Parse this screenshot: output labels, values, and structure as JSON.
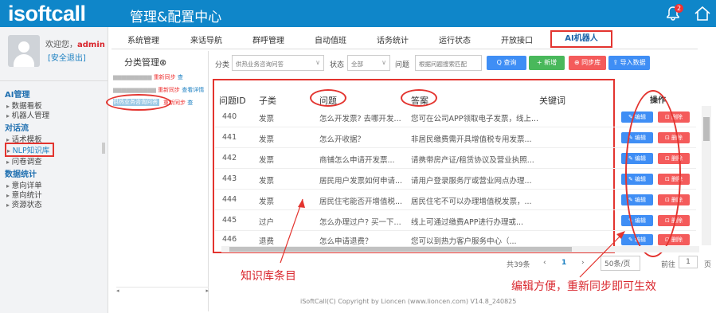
{
  "header": {
    "logo": "isoftcall",
    "title": "管理&配置中心",
    "notification_count": "2"
  },
  "sidebar": {
    "welcome_prefix": "欢迎您，",
    "username": "admin",
    "logout": "[安全退出]",
    "sections": [
      {
        "title": "AI管理",
        "items": [
          "数据看板",
          "机器人管理"
        ]
      },
      {
        "title": "对话流",
        "items": [
          "话术模板",
          "NLP知识库",
          "问卷调查"
        ]
      },
      {
        "title": "数据统计",
        "items": [
          "意向详单",
          "意向统计",
          "资源状态"
        ]
      }
    ]
  },
  "tabs": [
    "系统管理",
    "来话导航",
    "群呼管理",
    "自动值班",
    "话务统计",
    "运行状态",
    "开放接口",
    "AI机器人"
  ],
  "category_panel": {
    "title": "分类管理⊗",
    "rows": [
      {
        "label": "",
        "red": "重新同步",
        "blue": "查"
      },
      {
        "label": "",
        "red": "重新同步",
        "blue": "查看详情"
      },
      {
        "label": "",
        "red": "重新同步",
        "blue": "查"
      }
    ],
    "selected": "供热业务咨询问答"
  },
  "filters": {
    "category_label": "分类",
    "category_value": "供热业务咨询问答",
    "status_label": "状态",
    "status_value": "全部",
    "question_label": "问题",
    "question_placeholder": "根据问题搜索匹配"
  },
  "buttons": {
    "search": "Q 查询",
    "add": "+ 新增",
    "sync": "⊕ 同步库",
    "import": "⇪ 导入数据"
  },
  "table": {
    "headers": [
      "问题ID",
      "子类",
      "问题",
      "答案",
      "关键词"
    ],
    "op_header": "操作",
    "edit_label": "✎ 编辑",
    "delete_label": "⊡ 删除",
    "rows": [
      {
        "id": "440",
        "sub": "发票",
        "question": "怎么开发票? 去哪开发...",
        "answer": "您可在公司APP领取电子发票，线上..."
      },
      {
        "id": "441",
        "sub": "发票",
        "question": "怎么开收据？",
        "answer": "非居民缴费需开具增值税专用发票..."
      },
      {
        "id": "442",
        "sub": "发票",
        "question": "商铺怎么申请开发票...",
        "answer": "请携带房产证/租赁协议及营业执照..."
      },
      {
        "id": "443",
        "sub": "发票",
        "question": "居民用户发票如何申请...",
        "answer": "请用户登录服务厅或营业网点办理..."
      },
      {
        "id": "444",
        "sub": "发票",
        "question": "居民住宅能否开增值税...",
        "answer": "居民住宅不可以办理增值税发票，..."
      },
      {
        "id": "445",
        "sub": "过户",
        "question": "怎么办理过户? 买一下...",
        "answer": "线上可通过缴费APP进行办理或..."
      },
      {
        "id": "446",
        "sub": "退费",
        "question": "怎么申请退费？",
        "answer": "您可以到热力客户服务中心（..."
      }
    ]
  },
  "pagination": {
    "total": "共39条",
    "page": "1",
    "page_size": "50条/页",
    "goto_label": "前往",
    "goto_value": "1",
    "page_unit": "页"
  },
  "annotations": {
    "left": "知识库条目",
    "right": "编辑方便，重新同步即可生效"
  },
  "footer": "iSoftCall(C) Copyright by Lioncen (www.lioncen.com) V14.8_240825",
  "colors": {
    "primary": "#0f86c9",
    "annotation": "#e3342f",
    "delete": "#f45b5b",
    "edit": "#3f8ef5",
    "add": "#49b85b",
    "sync": "#f45b5b",
    "import": "#3f8ef5"
  }
}
